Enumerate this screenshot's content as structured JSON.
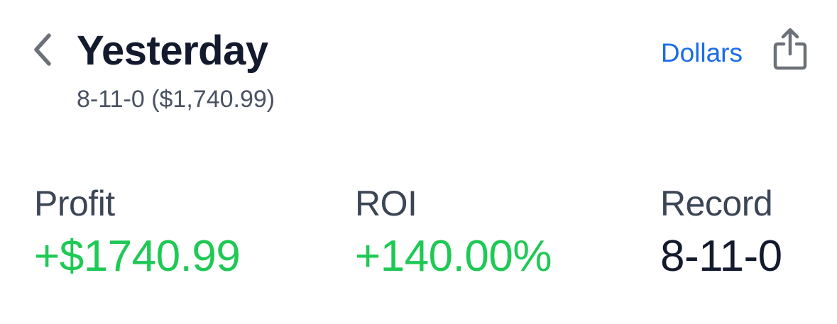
{
  "header": {
    "back_icon": "chevron-left-icon",
    "title": "Yesterday",
    "subtitle": "8-11-0 ($1,740.99)",
    "units_toggle_label": "Dollars",
    "share_icon": "share-icon"
  },
  "stats": [
    {
      "label": "Profit",
      "value": "+$1740.99"
    },
    {
      "label": "ROI",
      "value": "+140.00%"
    },
    {
      "label": "Record",
      "value": "8-11-0"
    }
  ],
  "colors": {
    "accent": "#1a6ce8",
    "positive": "#1ec954",
    "title": "#141a2e",
    "secondary_text": "#4a5262",
    "icon_gray": "#6b7079"
  }
}
